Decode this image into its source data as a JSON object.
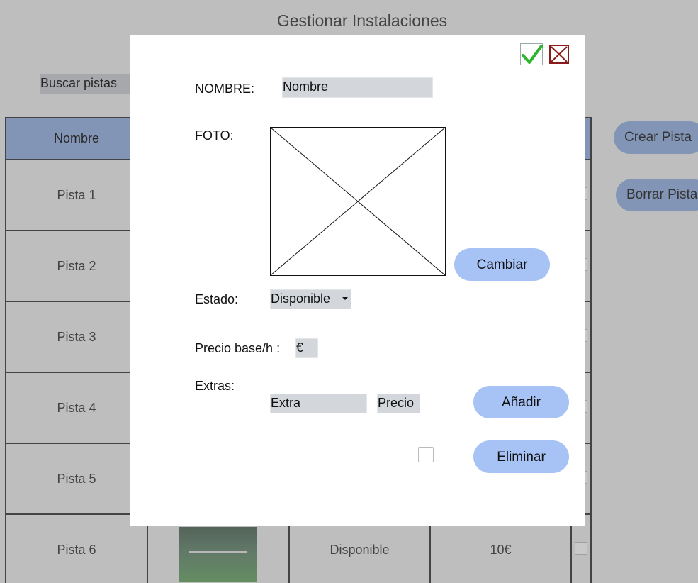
{
  "page": {
    "title": "Gestionar Instalaciones",
    "search_placeholder": "Buscar pistas",
    "create_button": "Crear Pista",
    "delete_button": "Borrar Pista"
  },
  "table": {
    "headers": [
      "Nombre"
    ],
    "rows": [
      {
        "name": "Pista 1"
      },
      {
        "name": "Pista 2"
      },
      {
        "name": "Pista 3"
      },
      {
        "name": "Pista 4"
      },
      {
        "name": "Pista 5"
      },
      {
        "name": "Pista 6",
        "status": "Disponible",
        "price": "10€"
      }
    ]
  },
  "modal": {
    "name_label": "NOMBRE:",
    "name_value": "Nombre",
    "photo_label": "FOTO:",
    "change_button": "Cambiar",
    "status_label": "Estado:",
    "status_value": "Disponible",
    "price_label": "Precio base/h :",
    "price_value": "€",
    "extras_label": "Extras:",
    "extra_field": "Extra",
    "extra_price_field": "Precio",
    "add_button": "Añadir",
    "delete_button": "Eliminar",
    "icons": {
      "confirm": "check-icon",
      "cancel": "close-icon"
    },
    "colors": {
      "confirm": "#2db52d",
      "cancel": "#8b1a1a",
      "button": "#a7c2f5"
    }
  }
}
